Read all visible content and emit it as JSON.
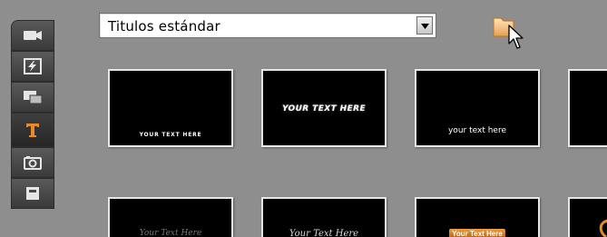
{
  "sidebar": {
    "tools": [
      {
        "icon": "video-camera-icon",
        "active": false
      },
      {
        "icon": "transitions-icon",
        "active": false
      },
      {
        "icon": "picture-in-picture-icon",
        "active": false
      },
      {
        "icon": "title-text-icon",
        "active": true
      },
      {
        "icon": "photo-camera-icon",
        "active": false
      },
      {
        "icon": "album-icon",
        "active": false
      }
    ]
  },
  "dropdown": {
    "value": "Titulos estándar",
    "icon": "chevron-down-icon"
  },
  "folder_button": {
    "icon": "folder-icon"
  },
  "thumbnails": [
    {
      "text": "YOUR TEXT HERE"
    },
    {
      "text": "YOUR TEXT HERE"
    },
    {
      "text": "your text here"
    },
    {
      "text": ""
    },
    {
      "text": "Your Text Here"
    },
    {
      "text": "Your Text Here"
    },
    {
      "text": "Your Text Here"
    },
    {
      "text": ""
    }
  ],
  "colors": {
    "background": "#8e8e8e",
    "accent_orange": "#e8892a",
    "tool_bg": "#4a4a4a"
  }
}
